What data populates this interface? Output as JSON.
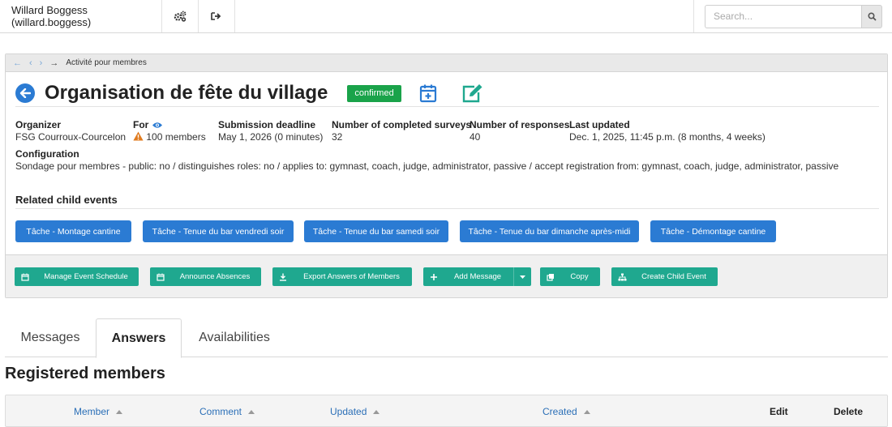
{
  "topbar": {
    "user": "Willard Boggess (willard.boggess)",
    "search_placeholder": "Search..."
  },
  "breadcrumb": {
    "current": "Activité pour membres"
  },
  "event": {
    "title": "Organisation de fête du village",
    "status": "confirmed"
  },
  "info": {
    "organizer_label": "Organizer",
    "organizer_value": "FSG Courroux-Courcelon",
    "for_label": "For",
    "for_value": "100 members",
    "deadline_label": "Submission deadline",
    "deadline_value": "May 1, 2026 (0 minutes)",
    "surveys_label": "Number of completed surveys",
    "surveys_value": "32",
    "responses_label": "Number of responses",
    "responses_value": "40",
    "updated_label": "Last updated",
    "updated_value": "Dec. 1, 2025, 11:45 p.m. (8 months, 4 weeks)"
  },
  "configuration": {
    "label": "Configuration",
    "value": "Sondage pour membres - public: no / distinguishes roles: no / applies to: gymnast, coach, judge, administrator, passive / accept registration from: gymnast, coach, judge, administrator, passive"
  },
  "related": {
    "title": "Related child events",
    "events": [
      "Tâche - Montage cantine",
      "Tâche - Tenue du bar vendredi soir",
      "Tâche - Tenue du bar samedi soir",
      "Tâche - Tenue du bar dimanche après-midi",
      "Tâche - Démontage cantine"
    ]
  },
  "actions": {
    "manage_schedule": "Manage Event Schedule",
    "announce_absences": "Announce Absences",
    "export_answers": "Export Answers of Members",
    "add_message": "Add Message",
    "copy": "Copy",
    "create_child": "Create Child Event"
  },
  "tabs": [
    "Messages",
    "Answers",
    "Availabilities"
  ],
  "active_tab": "Answers",
  "section_title": "Registered members",
  "table": {
    "columns": [
      "Member",
      "Comment",
      "Updated",
      "Created",
      "Edit",
      "Delete"
    ]
  },
  "colors": {
    "primary_blue": "#2b7bd3",
    "action_teal": "#1fa88f",
    "confirmed_green": "#1aa34a",
    "warning_orange": "#e07b1f"
  }
}
